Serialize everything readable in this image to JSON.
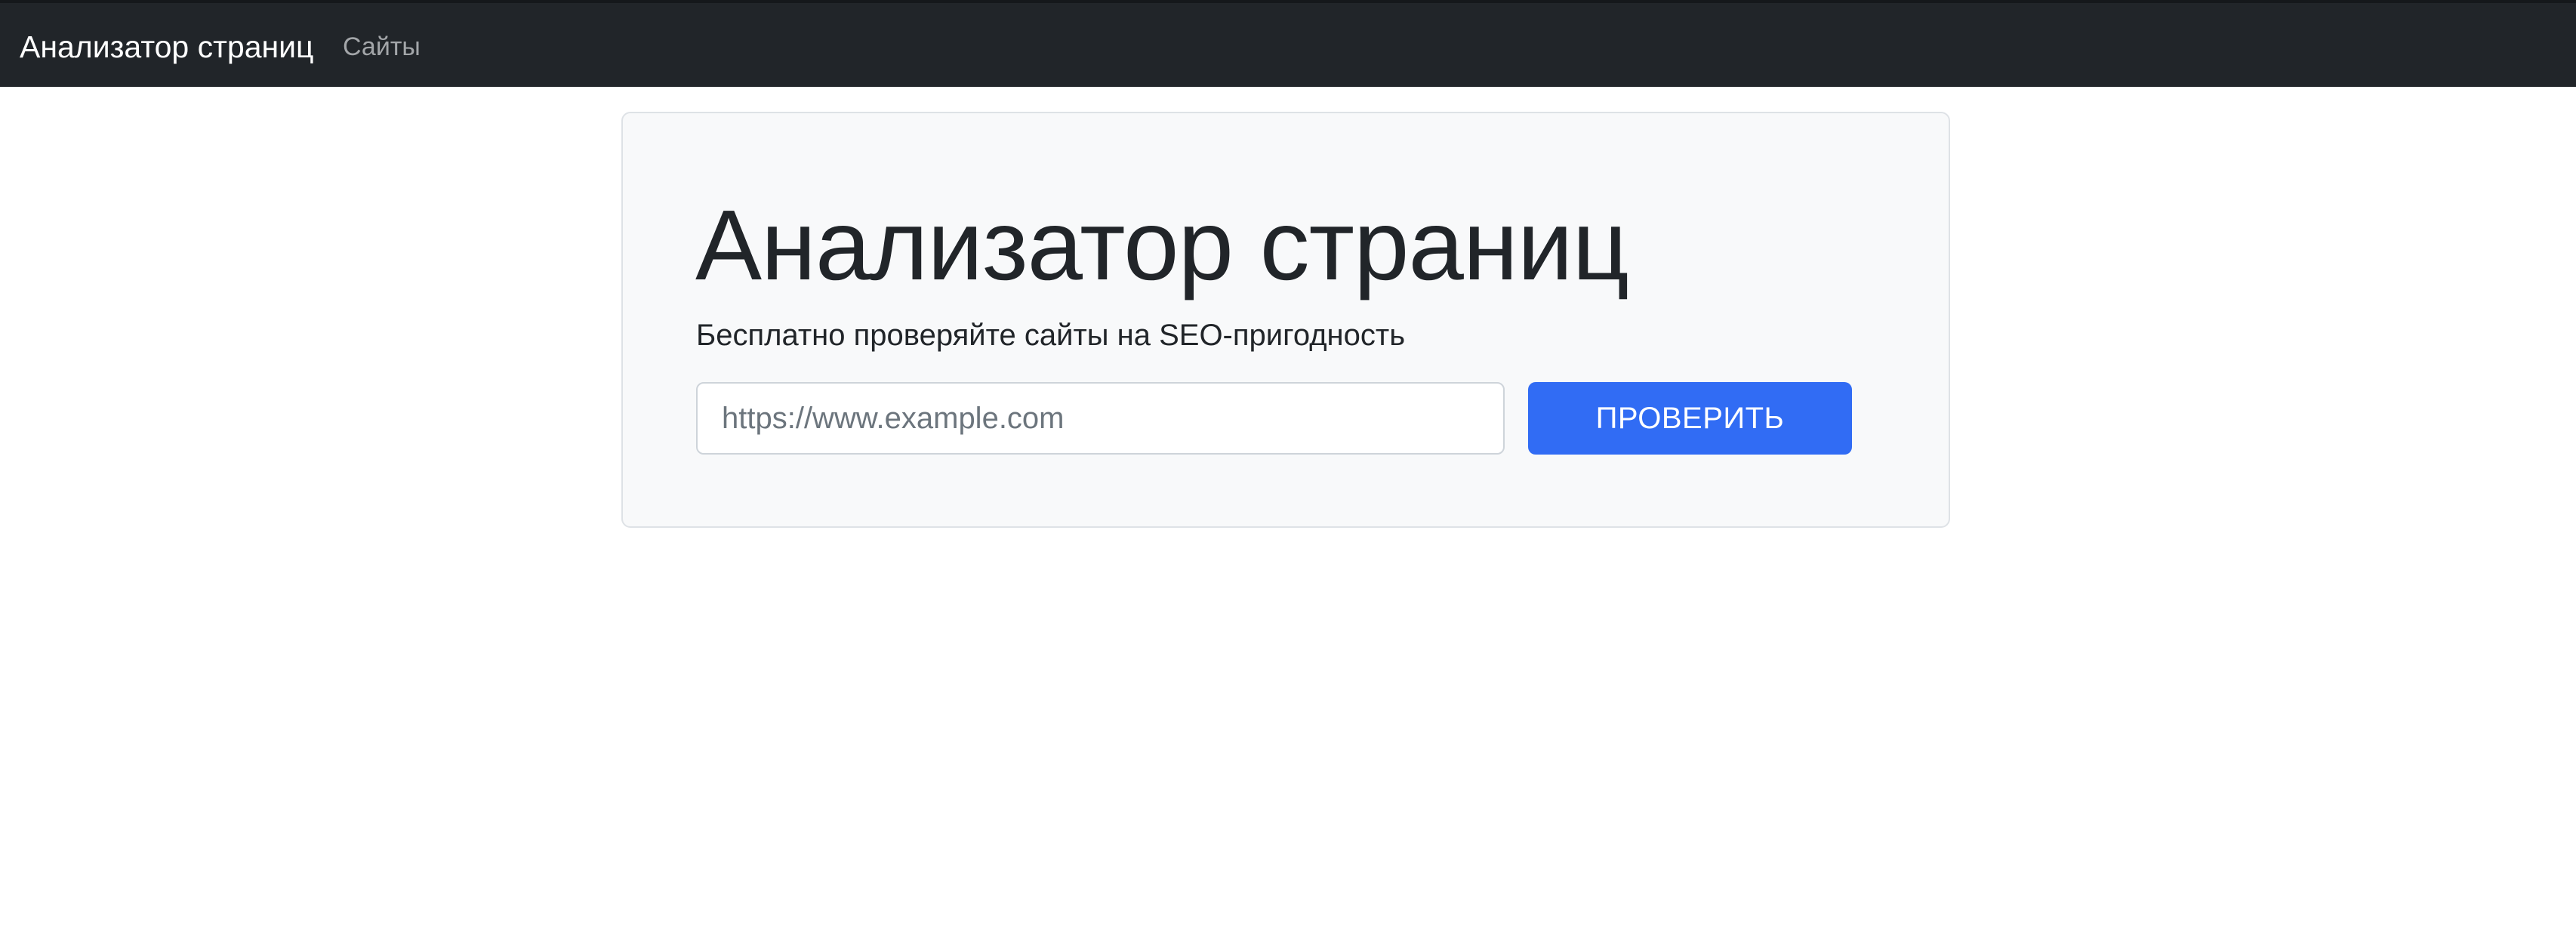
{
  "navbar": {
    "brand": "Анализатор страниц",
    "links": [
      {
        "label": "Сайты"
      }
    ]
  },
  "hero": {
    "title": "Анализатор страниц",
    "lead": "Бесплатно проверяйте сайты на SEO-пригодность",
    "form": {
      "url_input": {
        "value": "",
        "placeholder": "https://www.example.com"
      },
      "submit_label": "ПРОВЕРИТЬ"
    }
  },
  "colors": {
    "navbar_bg": "#212529",
    "hero_bg": "#f8f9fa",
    "primary": "#316cf4",
    "text": "#212529",
    "muted_link": "#a3a6a9"
  }
}
